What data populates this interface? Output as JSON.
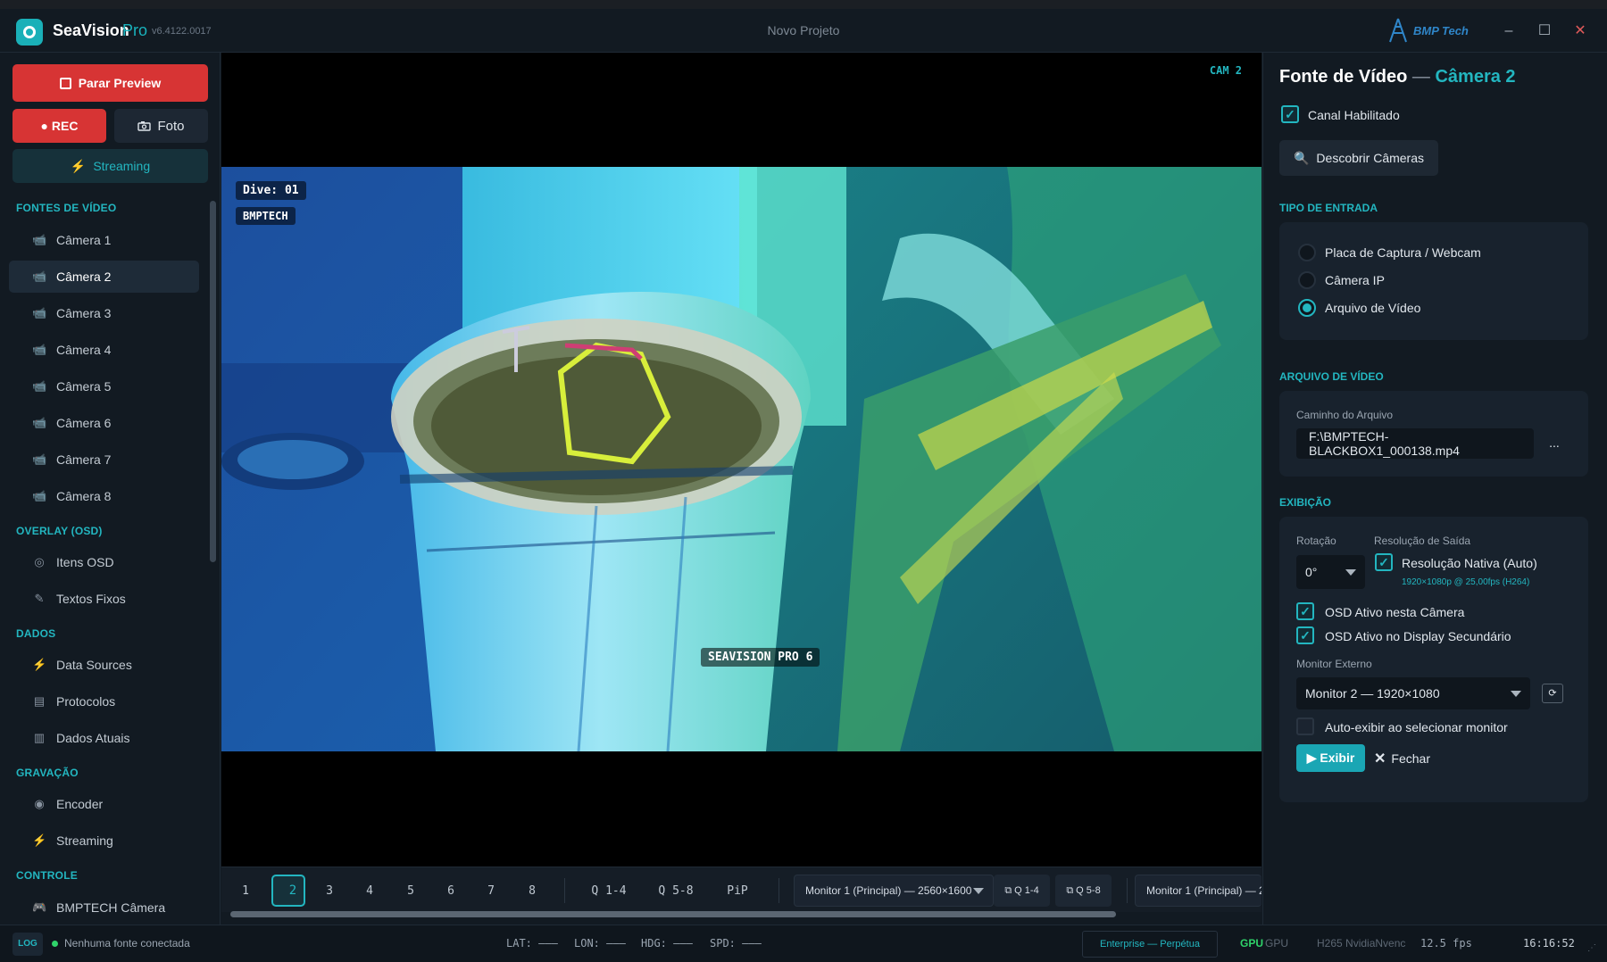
{
  "app": {
    "name": "SeaVision",
    "edition": "Pro",
    "version": "v6.4122.0017",
    "project": "Novo Projeto",
    "brand": "BMP Tech"
  },
  "window_controls": {
    "minimize": "–",
    "maximize": "☐",
    "close": "✕"
  },
  "sidebar": {
    "stop_preview": "Parar Preview",
    "rec": "● REC",
    "photo": "Foto",
    "streaming": "Streaming",
    "sections": [
      {
        "title": "FONTES DE VÍDEO",
        "items": [
          "Câmera 1",
          "Câmera 2",
          "Câmera 3",
          "Câmera 4",
          "Câmera 5",
          "Câmera 6",
          "Câmera 7",
          "Câmera 8"
        ]
      },
      {
        "title": "OVERLAY (OSD)",
        "items": [
          "Itens OSD",
          "Textos Fixos"
        ]
      },
      {
        "title": "DADOS",
        "items": [
          "Data Sources",
          "Protocolos",
          "Dados Atuais"
        ]
      },
      {
        "title": "GRAVAÇÃO",
        "items": [
          "Encoder",
          "Streaming"
        ]
      },
      {
        "title": "CONTROLE",
        "items": [
          "BMPTECH Câmera"
        ]
      }
    ],
    "active_item": "Câmera 2"
  },
  "video": {
    "cam_tag": "CAM 2",
    "osd_dive": "Dive: 01",
    "osd_company": "BMPTECH",
    "osd_product": "SEAVISION PRO 6"
  },
  "control_bar": {
    "channels": [
      "1",
      "2",
      "3",
      "4",
      "5",
      "6",
      "7",
      "8"
    ],
    "selected_channel": "2",
    "layouts": [
      "Q 1-4",
      "Q 5-8",
      "PiP"
    ],
    "monitor_select": "Monitor 1 (Principal) — 2560×1600",
    "quad_a": "Q 1-4",
    "quad_b": "Q 5-8",
    "monitor_select_2": "Monitor 1 (Principal) — 2"
  },
  "panel": {
    "title": "Fonte de Vídeo",
    "title_dash": "—",
    "title_camera": "Câmera 2",
    "channel_enabled": "Canal Habilitado",
    "discover": "Descobrir Câmeras",
    "input_type_title": "TIPO DE ENTRADA",
    "input_types": [
      "Placa de Captura / Webcam",
      "Câmera IP",
      "Arquivo de Vídeo"
    ],
    "input_selected": "Arquivo de Vídeo",
    "file_section": "ARQUIVO DE VÍDEO",
    "file_path_label": "Caminho do Arquivo",
    "file_path": "F:\\BMPTECH-BLACKBOX1_000138.mp4",
    "browse": "...",
    "display_section": "EXIBIÇÃO",
    "rotation_label": "Rotação",
    "rotation_value": "0°",
    "output_res_label": "Resolução de Saída",
    "native_res": "Resolução Nativa (Auto)",
    "native_res_info": "1920×1080p @ 25,00fps (H264)",
    "osd_camera": "OSD Ativo nesta Câmera",
    "osd_secondary": "OSD Ativo no Display Secundário",
    "ext_monitor_label": "Monitor Externo",
    "ext_monitor_value": "Monitor 2 — 1920×1080",
    "auto_show": "Auto-exibir ao selecionar monitor",
    "show_btn": "▶ Exibir",
    "close_btn": "Fechar"
  },
  "status": {
    "log": "LOG",
    "connection": "Nenhuma fonte conectada",
    "lat": "LAT: ———",
    "lon": "LON: ———",
    "hdg": "HDG: ———",
    "spd": "SPD: ———",
    "license": "Enterprise — Perpétua",
    "gpu_label": "GPU",
    "gpu_value": "GPU",
    "codec": "H265 NvidiaNvenc",
    "fps": "12.5 fps",
    "time": "16:16:52"
  },
  "colors": {
    "accent": "#23b6c0",
    "danger": "#d73434",
    "bg": "#121a22",
    "card": "#18222d"
  }
}
